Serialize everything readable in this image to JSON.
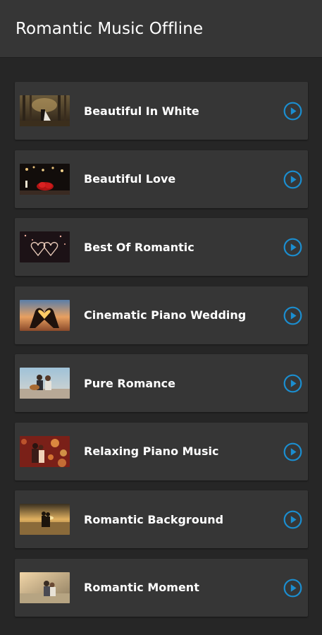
{
  "app": {
    "title": "Romantic Music Offline"
  },
  "accent_color": "#1b8ed0",
  "songs": [
    {
      "title": "Beautiful In White",
      "thumb_icon": "forest-couple-thumbnail"
    },
    {
      "title": "Beautiful Love",
      "thumb_icon": "candles-roses-thumbnail"
    },
    {
      "title": "Best Of Romantic",
      "thumb_icon": "glowing-hearts-thumbnail"
    },
    {
      "title": "Cinematic Piano Wedding",
      "thumb_icon": "heart-hands-sunset-thumbnail"
    },
    {
      "title": "Pure Romance",
      "thumb_icon": "guitar-couple-thumbnail"
    },
    {
      "title": "Relaxing Piano Music",
      "thumb_icon": "bokeh-couple-thumbnail"
    },
    {
      "title": "Romantic Background",
      "thumb_icon": "beach-sunset-couple-thumbnail"
    },
    {
      "title": "Romantic Moment",
      "thumb_icon": "sunlit-couple-thumbnail"
    }
  ]
}
